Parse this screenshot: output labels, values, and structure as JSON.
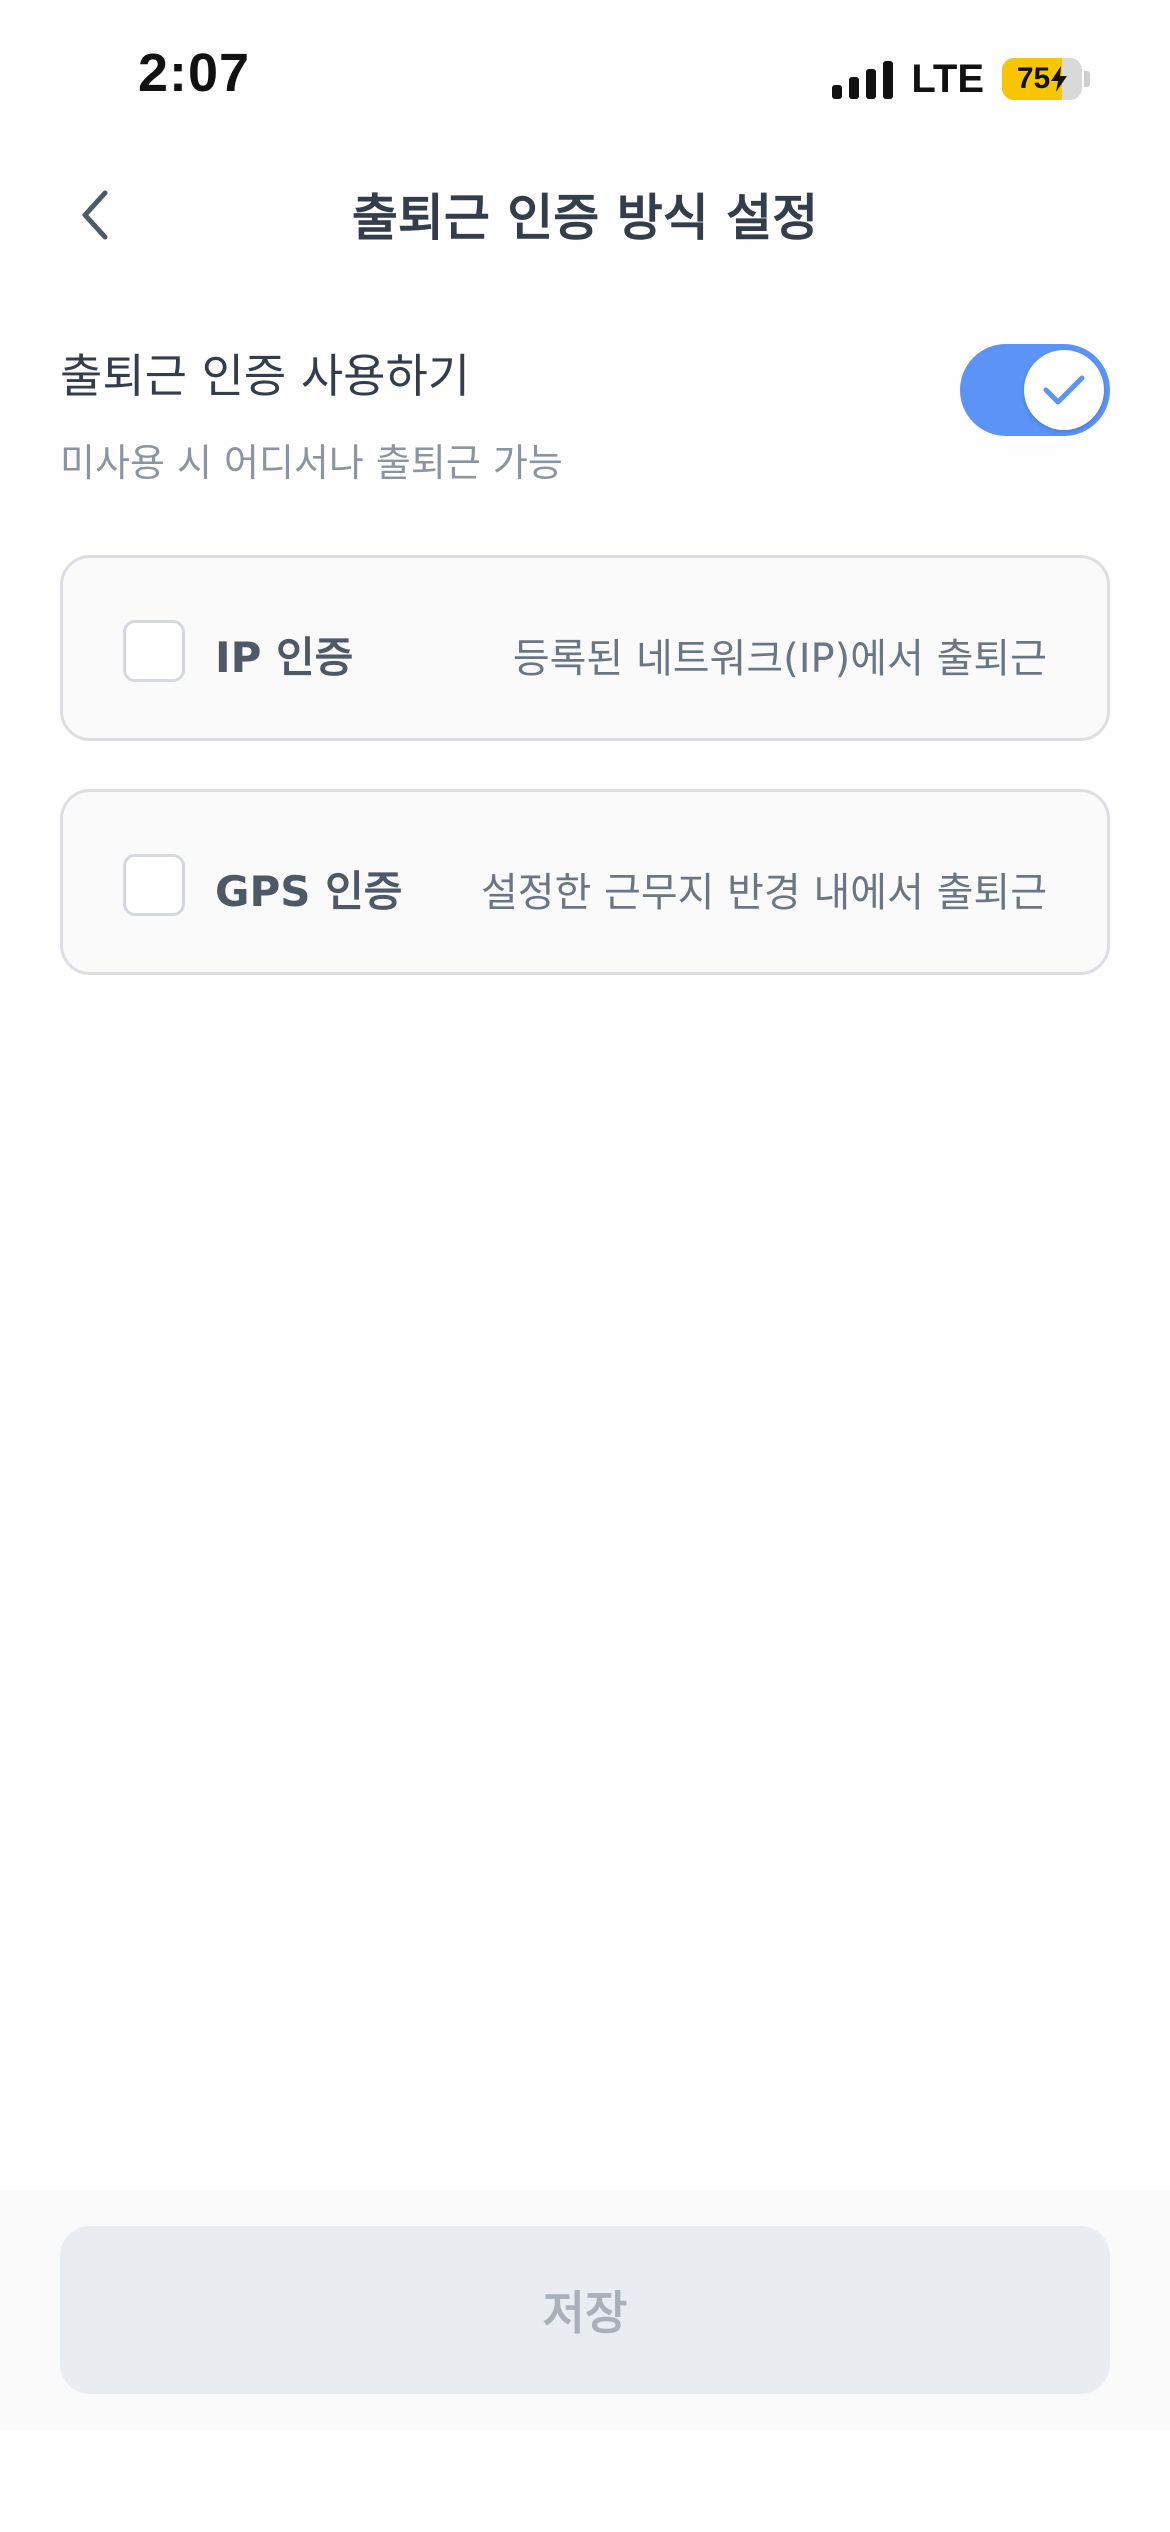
{
  "status_bar": {
    "time": "2:07",
    "network": "LTE",
    "battery": "75",
    "battery_level_percent": 75
  },
  "header": {
    "title": "출퇴근 인증 방식 설정"
  },
  "toggle_section": {
    "title": "출퇴근 인증 사용하기",
    "description": "미사용 시 어디서나 출퇴근 가능",
    "enabled": true
  },
  "options": [
    {
      "label": "IP 인증",
      "description": "등록된 네트워크(IP)에서 출퇴근",
      "checked": false
    },
    {
      "label": "GPS 인증",
      "description": "설정한 근무지 반경 내에서 출퇴근",
      "checked": false
    }
  ],
  "footer": {
    "save_label": "저장"
  },
  "colors": {
    "accent": "#5b93f7",
    "battery": "#f7c600",
    "disabled_button": "#e9ecf1"
  },
  "icons": {
    "back": "chevron-left-icon",
    "toggle_check": "check-icon",
    "charging": "bolt-icon"
  }
}
